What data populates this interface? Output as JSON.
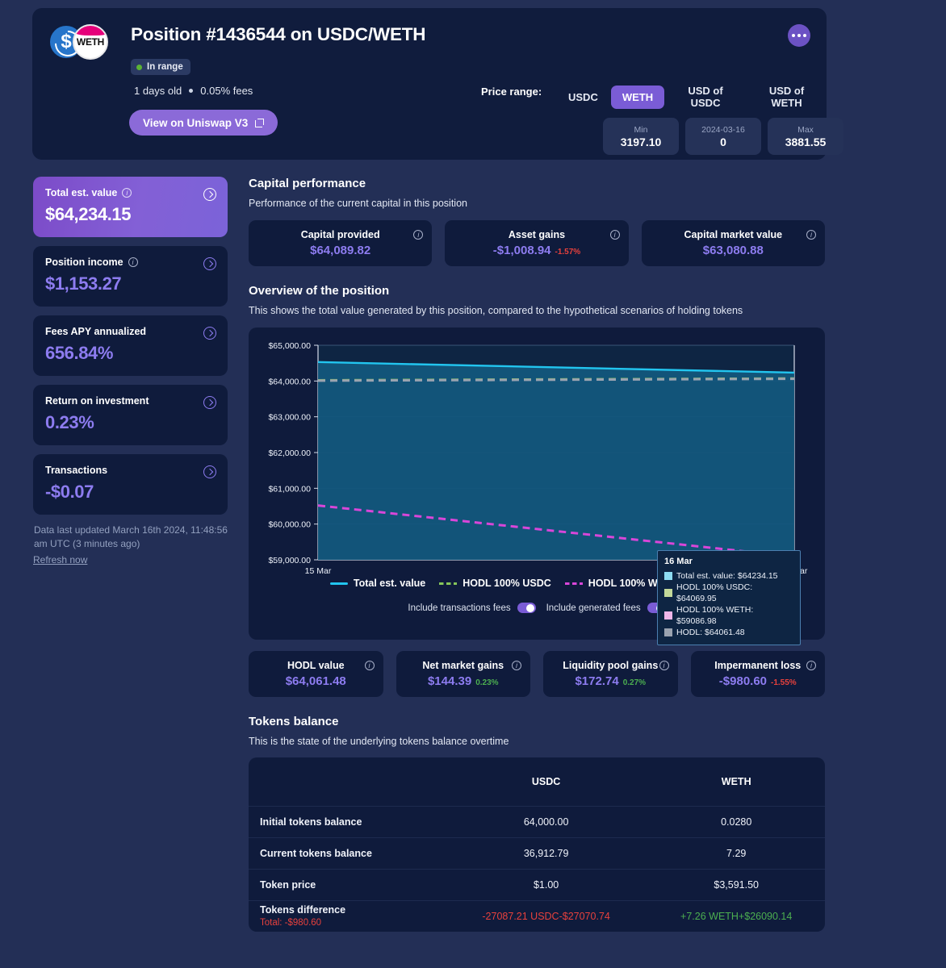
{
  "header": {
    "title": "Position #1436544 on USDC/WETH",
    "token0_symbol": "USDC",
    "token1_symbol": "WETH",
    "status_badge": "In range",
    "age": "1 days old",
    "fee_tier": "0.05% fees",
    "uniswap_button": "View on Uniswap V3",
    "menu_icon": "more-icon",
    "price_range": {
      "label": "Price range:",
      "tabs": [
        "USDC",
        "WETH",
        "USD of USDC",
        "USD of WETH"
      ],
      "active_tab": "WETH",
      "boxes": [
        {
          "cap": "Min",
          "val": "3197.10"
        },
        {
          "cap": "2024-03-16",
          "val": "0"
        },
        {
          "cap": "Max",
          "val": "3881.55"
        }
      ]
    }
  },
  "sidebar": {
    "cards": [
      {
        "label": "Total est. value",
        "value": "$64,234.15",
        "has_info": true,
        "highlight": true
      },
      {
        "label": "Position income",
        "value": "$1,153.27",
        "has_info": true,
        "highlight": false
      },
      {
        "label": "Fees APY annualized",
        "value": "656.84%",
        "has_info": false,
        "highlight": false
      },
      {
        "label": "Return on investment",
        "value": "0.23%",
        "has_info": false,
        "highlight": false
      },
      {
        "label": "Transactions",
        "value": "-$0.07",
        "has_info": false,
        "highlight": false
      }
    ],
    "updated_text": "Data last updated March 16th 2024, 11:48:56 am UTC (3 minutes ago)",
    "refresh_label": "Refresh now"
  },
  "capital": {
    "title": "Capital performance",
    "subtitle": "Performance of the current capital in this position",
    "cards": [
      {
        "label": "Capital provided",
        "value": "$64,089.82",
        "pct": "",
        "pct_sign": ""
      },
      {
        "label": "Asset gains",
        "value": "-$1,008.94",
        "pct": "-1.57%",
        "pct_sign": "neg"
      },
      {
        "label": "Capital market value",
        "value": "$63,080.88",
        "pct": "",
        "pct_sign": ""
      }
    ]
  },
  "overview": {
    "title": "Overview of the position",
    "subtitle": "This shows the total value generated by this position, compared to the hypothetical scenarios of holding tokens",
    "toggles": [
      {
        "label": "Include transactions fees",
        "on": true
      },
      {
        "label": "Include generated fees",
        "on": true
      }
    ],
    "tooltip": {
      "title": "16 Mar",
      "rows": [
        {
          "label": "Total est. value: $64234.15",
          "color": "#8ddcf2"
        },
        {
          "label": "HODL 100% USDC: $64069.95",
          "color": "#c3d99a"
        },
        {
          "label": "HODL 100% WETH: $59086.98",
          "color": "#f0b6ea"
        },
        {
          "label": "HODL: $64061.48",
          "color": "#9aa3b0"
        }
      ]
    }
  },
  "chart_data": {
    "type": "line",
    "title": "Overview of the position",
    "xlabel": "",
    "ylabel": "",
    "x": [
      "15 Mar",
      "16 Mar"
    ],
    "xticklabels": [
      "15 Mar",
      "16 Mar"
    ],
    "yticklabels": [
      "$59,000.00",
      "$60,000.00",
      "$61,000.00",
      "$62,000.00",
      "$63,000.00",
      "$64,000.00",
      "$65,000.00"
    ],
    "ylim": [
      59000,
      65000
    ],
    "grid": true,
    "legend_position": "bottom",
    "series": [
      {
        "name": "Total est. value",
        "color": "#22c5ef",
        "style": "solid",
        "fill": true,
        "values": [
          64530,
          64234.15
        ]
      },
      {
        "name": "HODL 100% USDC",
        "color": "#86c65a",
        "style": "dashed",
        "fill": false,
        "values": [
          64020,
          64069.95
        ]
      },
      {
        "name": "HODL 100% WETH",
        "color": "#d946d9",
        "style": "dashed",
        "fill": false,
        "values": [
          60520,
          59086.98
        ]
      },
      {
        "name": "HODL",
        "color": "#9aa3b0",
        "style": "dashed",
        "fill": false,
        "values": [
          64010,
          64061.48
        ]
      }
    ]
  },
  "hodl_stats": [
    {
      "label": "HODL value",
      "value": "$64,061.48",
      "pct": "",
      "pct_sign": ""
    },
    {
      "label": "Net market gains",
      "value": "$144.39",
      "pct": "0.23%",
      "pct_sign": "pos"
    },
    {
      "label": "Liquidity pool gains",
      "value": "$172.74",
      "pct": "0.27%",
      "pct_sign": "pos"
    },
    {
      "label": "Impermanent loss",
      "value": "-$980.60",
      "pct": "-1.55%",
      "pct_sign": "neg"
    }
  ],
  "tokens": {
    "title": "Tokens balance",
    "subtitle": "This is the state of the underlying tokens balance overtime",
    "columns": [
      "",
      "USDC",
      "WETH"
    ],
    "rows": [
      {
        "label": "Initial tokens balance",
        "usdc": "64,000.00",
        "weth": "0.0280",
        "usdc_color": "",
        "weth_color": ""
      },
      {
        "label": "Current tokens balance",
        "usdc": "36,912.79",
        "weth": "7.29",
        "usdc_color": "",
        "weth_color": ""
      },
      {
        "label": "Token price",
        "usdc": "$1.00",
        "weth": "$3,591.50",
        "usdc_color": "",
        "weth_color": ""
      },
      {
        "label": "Tokens difference",
        "sub": "Total: -$980.60",
        "usdc": "-27087.21 USDC-$27070.74",
        "weth": "+7.26 WETH+$26090.14",
        "usdc_color": "red",
        "weth_color": "green"
      }
    ]
  }
}
